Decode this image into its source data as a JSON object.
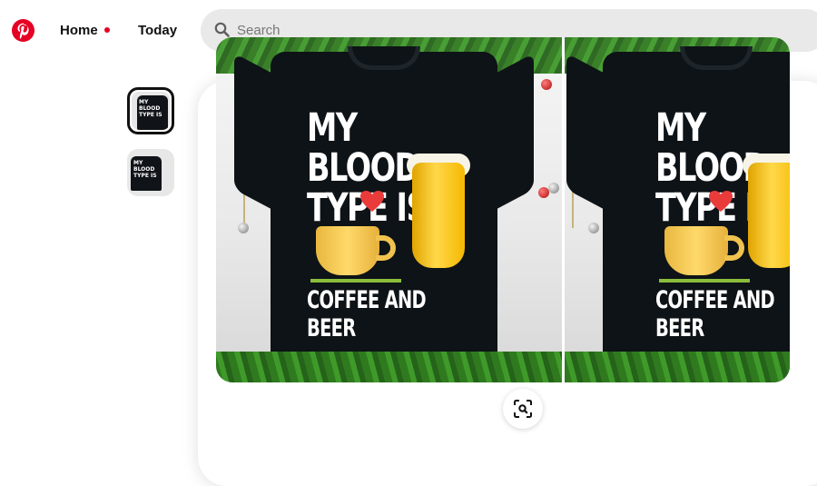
{
  "header": {
    "nav": [
      {
        "label": "Home",
        "active": true
      },
      {
        "label": "Today",
        "active": false
      }
    ],
    "search": {
      "placeholder": "Search"
    }
  },
  "pin": {
    "thumbnails": [
      {
        "label": "thumbnail-1",
        "selected": true
      },
      {
        "label": "thumbnail-2",
        "selected": false
      }
    ],
    "image": {
      "print_line1": "MY BLOOD",
      "print_line2": "TYPE IS",
      "print_footer": "COFFEE AND BEER"
    }
  },
  "colors": {
    "brand": "#e60023",
    "search_bg": "#e9e9e9",
    "shirt": "#0e1317"
  },
  "icons": {
    "logo": "pinterest-logo-icon",
    "search": "search-icon",
    "zoom": "visual-search-icon"
  }
}
